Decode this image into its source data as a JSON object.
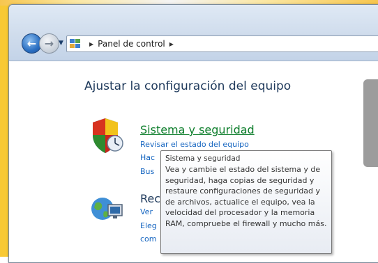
{
  "breadcrumb": {
    "items": [
      "Panel de control"
    ]
  },
  "page": {
    "heading": "Ajustar la configuración del equipo"
  },
  "categories": [
    {
      "title": "Sistema y seguridad",
      "icon": "shield-icon",
      "links": [
        "Revisar el estado del equipo",
        "Hac",
        "Bus"
      ]
    },
    {
      "title": "Rec",
      "icon": "network-globe-icon",
      "links": [
        "Ver",
        "Eleg",
        "com"
      ]
    }
  ],
  "tooltip": {
    "title": "Sistema y seguridad",
    "body": "Vea y cambie el estado del sistema y de seguridad, haga copias de seguridad y restaure configuraciones de seguridad y de archivos, actualice el equipo, vea la velocidad del procesador y la memoria RAM, compruebe el firewall y mucho más."
  },
  "colors": {
    "link_green": "#0e7e2c",
    "link_blue": "#1565c0",
    "heading": "#1e395b",
    "frame_yellow": "#f8c934"
  }
}
